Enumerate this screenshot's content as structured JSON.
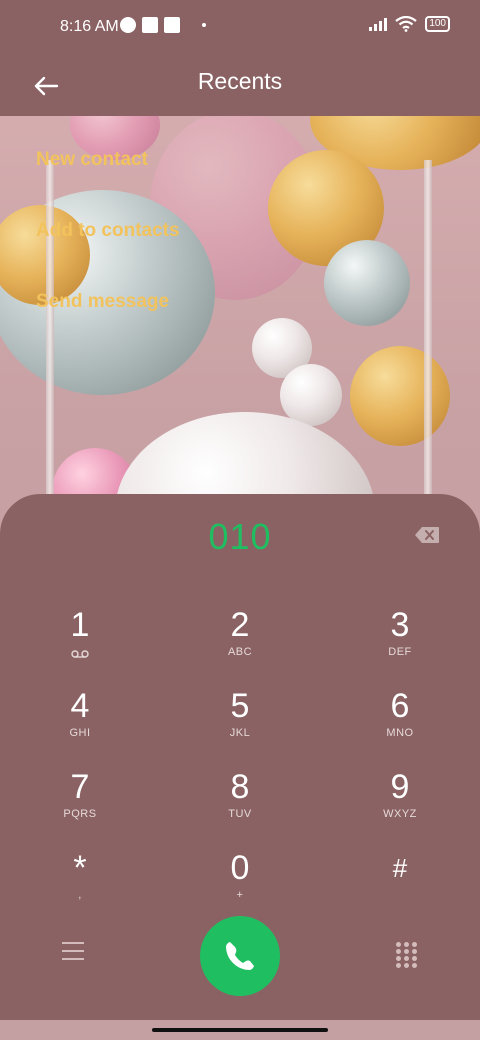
{
  "status_bar": {
    "time": "8:16 AM",
    "battery": "100"
  },
  "header": {
    "title": "Recents"
  },
  "actions": [
    {
      "label": "New contact"
    },
    {
      "label": "Add to contacts"
    },
    {
      "label": "Send message"
    }
  ],
  "dialpad": {
    "number": "010",
    "keys": [
      {
        "digit": "1",
        "letters": ""
      },
      {
        "digit": "2",
        "letters": "ABC"
      },
      {
        "digit": "3",
        "letters": "DEF"
      },
      {
        "digit": "4",
        "letters": "GHI"
      },
      {
        "digit": "5",
        "letters": "JKL"
      },
      {
        "digit": "6",
        "letters": "MNO"
      },
      {
        "digit": "7",
        "letters": "PQRS"
      },
      {
        "digit": "8",
        "letters": "TUV"
      },
      {
        "digit": "9",
        "letters": "WXYZ"
      },
      {
        "digit": "*",
        "letters": ","
      },
      {
        "digit": "0",
        "letters": "+"
      },
      {
        "digit": "#",
        "letters": ""
      }
    ]
  },
  "colors": {
    "accent_green": "#1fbf61",
    "action_gold": "#f2c35c",
    "panel": "#8a6263"
  },
  "icons": {
    "back": "arrow-left-icon",
    "backspace": "backspace-icon",
    "voicemail": "voicemail-icon",
    "call": "phone-icon",
    "menu": "menu-icon",
    "dialpad": "dialpad-icon"
  }
}
